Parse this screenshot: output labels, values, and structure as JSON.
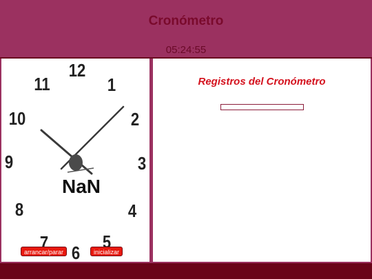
{
  "header": {
    "title": "Cronómetro",
    "time": "05:24:55"
  },
  "clock": {
    "numbers": [
      "12",
      "1",
      "2",
      "3",
      "4",
      "5",
      "6",
      "7",
      "8",
      "9",
      "10",
      "11"
    ],
    "readout": "NaN",
    "buttons": {
      "start_stop": "arrancar/parar",
      "reset": "inicializar"
    }
  },
  "registros": {
    "title": "Registros del Cronómetro",
    "value": ""
  },
  "colors": {
    "header_bg": "#9b3160",
    "title": "#7a0a2c",
    "button_bg": "#e8190f",
    "registros_title": "#d4121e",
    "footer": "#6a0418"
  }
}
